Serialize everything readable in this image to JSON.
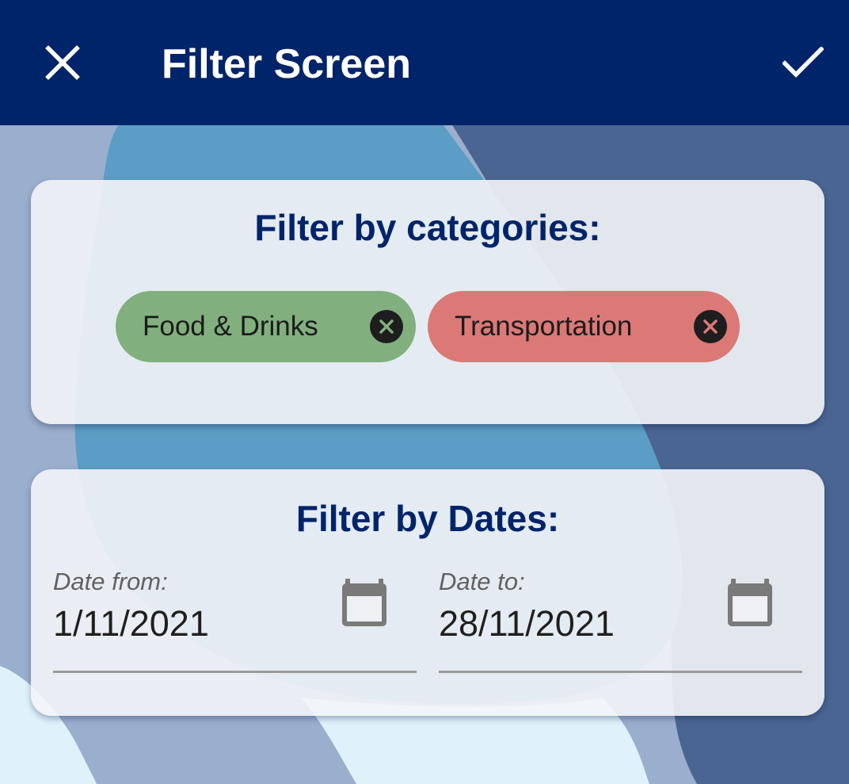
{
  "appbar": {
    "title": "Filter Screen",
    "close_icon": "close-icon",
    "confirm_icon": "check-icon",
    "background": "#00246a"
  },
  "categories": {
    "title": "Filter by categories:",
    "chips": [
      {
        "label": "Food & Drinks",
        "color": "#81b07e",
        "icon": "close-circle-icon"
      },
      {
        "label": "Transportation",
        "color": "#db7977",
        "icon": "close-circle-icon"
      }
    ]
  },
  "dates": {
    "title": "Filter by Dates:",
    "from": {
      "label": "Date from:",
      "value": "1/11/2021",
      "icon": "calendar-icon"
    },
    "to": {
      "label": "Date to:",
      "value": "28/11/2021",
      "icon": "calendar-icon"
    }
  },
  "colors": {
    "primary": "#00246a",
    "background_blob_light": "#dff2fb",
    "background_blob_mid": "#5b9dc4",
    "background_blob_dark": "#4a6592"
  }
}
